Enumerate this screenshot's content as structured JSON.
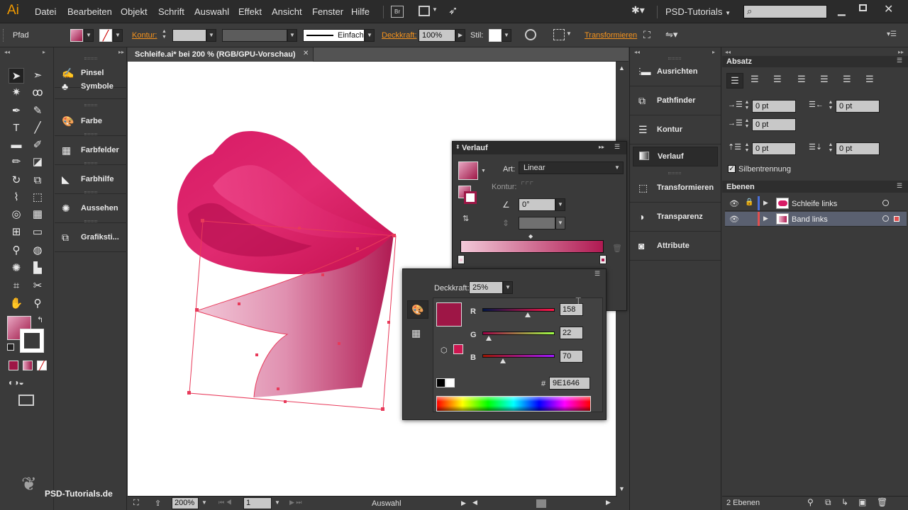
{
  "app": {
    "logo": "Ai",
    "workspace": "PSD-Tutorials",
    "search_placeholder": ""
  },
  "menu": [
    "Datei",
    "Bearbeiten",
    "Objekt",
    "Schrift",
    "Auswahl",
    "Effekt",
    "Ansicht",
    "Fenster",
    "Hilfe"
  ],
  "control_bar": {
    "object_type": "Pfad",
    "kontur_label": "Kontur:",
    "stroke_style": "Einfach",
    "deckkraft_label": "Deckkraft:",
    "deckkraft_value": "100%",
    "stil_label": "Stil:",
    "transform_label": "Transformieren"
  },
  "document_tab": {
    "title": "Schleife.ai* bei 200 % (RGB/GPU-Vorschau)"
  },
  "left_panels": [
    "Pinsel",
    "Symbole",
    "Farbe",
    "Farbfelder",
    "Farbhilfe",
    "Aussehen",
    "Grafiksti..."
  ],
  "right_panels": [
    "Ausrichten",
    "Pathfinder",
    "Kontur",
    "Verlauf",
    "Transformieren",
    "Transparenz",
    "Attribute"
  ],
  "absatz": {
    "title": "Absatz",
    "indent_left": "0 pt",
    "indent_right": "0 pt",
    "first_line": "0 pt",
    "space_before": "0 pt",
    "space_after": "0 pt",
    "hyphenation": "Silbentrennung"
  },
  "ebenen": {
    "title": "Ebenen",
    "layers": [
      {
        "name": "Schleife links"
      },
      {
        "name": "Band links"
      }
    ],
    "count": "2 Ebenen"
  },
  "verlauf": {
    "title": "Verlauf",
    "art_label": "Art:",
    "art_value": "Linear",
    "kontur_label": "Kontur:",
    "angle": "0°"
  },
  "farbe": {
    "deckkraft_label": "Deckkraft:",
    "deckkraft_value": "25%",
    "r_label": "R",
    "r_value": "158",
    "g_label": "G",
    "g_value": "22",
    "b_label": "B",
    "b_value": "70",
    "hex_label": "#",
    "hex_value": "9E1646",
    "swatch_color": "#9E1646"
  },
  "status": {
    "zoom": "200%",
    "artboard": "1",
    "tool": "Auswahl"
  },
  "watermark": "PSD-Tutorials.de"
}
